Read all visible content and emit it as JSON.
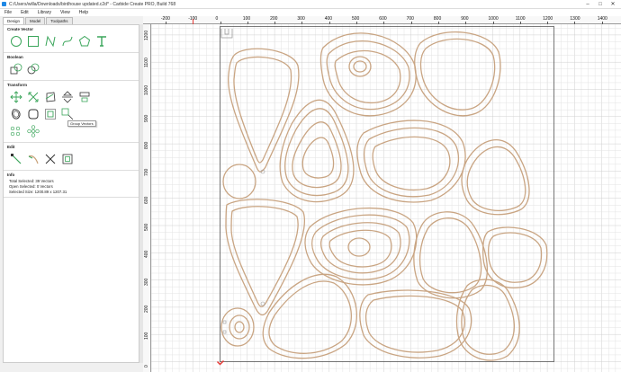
{
  "window": {
    "title": "C:/Users/willa/Downloads/birdhouse updated.c2d* - Carbide Create PRO, Build 768",
    "controls": [
      "–",
      "□",
      "✕"
    ]
  },
  "menu": [
    "File",
    "Edit",
    "Library",
    "View",
    "Help"
  ],
  "tabs": [
    "Design",
    "Model",
    "Toolpaths"
  ],
  "sections": {
    "create_vector": "Create Vector",
    "boolean": "Boolean",
    "transform": "Transform",
    "edit": "Edit",
    "info": "Info"
  },
  "tooltip": "Group Vectors",
  "info": {
    "total_selected": "Total Selected:  39 Vectors",
    "open_selected": "Open Selected:   0 Vectors",
    "selected_size": "Selected Size:   1200.89 x 1207.31"
  },
  "ruler_x": [
    "-200",
    "-100",
    "0",
    "100",
    "200",
    "300",
    "400",
    "500",
    "600",
    "700",
    "800",
    "900",
    "1000",
    "1100",
    "1200",
    "1300",
    "1400"
  ],
  "ruler_y": [
    "1200",
    "1100",
    "1000",
    "900",
    "800",
    "700",
    "600",
    "500",
    "400",
    "300",
    "200",
    "100",
    "0"
  ],
  "colors": {
    "shape_stroke": "#c9a583",
    "grid": "#e3e3e3",
    "grid_major": "#cfcfcf",
    "icon_green": "#3aa55a",
    "cursor_red": "#e53935"
  }
}
